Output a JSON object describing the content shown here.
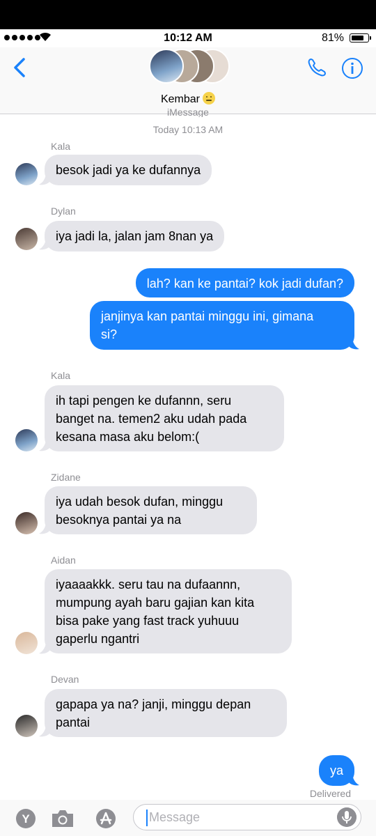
{
  "status_bar": {
    "time": "10:12 AM",
    "battery_percent": "81%",
    "battery_level": 0.81,
    "signal_bars": 5
  },
  "header": {
    "back_icon": "chevron-left-icon",
    "contact_name": "Kembar",
    "contact_emoji": "neutral-face-emoji",
    "phone_icon": "phone-icon",
    "info_icon": "info-icon",
    "accent_color": "#1a82fb"
  },
  "thread": {
    "service_label": "iMessage",
    "timestamp": "Today 10:13 AM",
    "delivered_label": "Delivered"
  },
  "messages": [
    {
      "sender": "Kala",
      "direction": "incoming",
      "lines": [
        "besok jadi ya ke dufannya"
      ]
    },
    {
      "sender": "Dylan",
      "direction": "incoming",
      "lines": [
        "iya jadi la, jalan jam 8nan ya"
      ]
    },
    {
      "sender": "",
      "direction": "outgoing",
      "lines": [
        "lah? kan ke pantai? kok jadi dufan?"
      ]
    },
    {
      "sender": "",
      "direction": "outgoing",
      "lines": [
        "janjinya kan pantai minggu ini, gimana",
        "si?"
      ]
    },
    {
      "sender": "Kala",
      "direction": "incoming",
      "lines": [
        "ih tapi pengen ke dufannn, seru",
        "banget na. temen2 aku udah pada",
        "kesana masa aku belom:("
      ]
    },
    {
      "sender": "Zidane",
      "direction": "incoming",
      "lines": [
        "iya udah besok dufan, minggu",
        "besoknya pantai ya na"
      ]
    },
    {
      "sender": "Aidan",
      "direction": "incoming",
      "lines": [
        "iyaaaakkk. seru tau na dufaannn,",
        "mumpung ayah baru gajian kan kita",
        "bisa pake yang fast track yuhuuu",
        "gaperlu ngantri"
      ]
    },
    {
      "sender": "Devan",
      "direction": "incoming",
      "lines": [
        "gapapa ya na? janji, minggu depan",
        "pantai"
      ]
    },
    {
      "sender": "",
      "direction": "outgoing",
      "lines": [
        "ya"
      ]
    }
  ],
  "composer": {
    "placeholder": "Message",
    "app_icons": [
      "y-app-icon",
      "camera-icon",
      "app-store-icon"
    ],
    "mic_icon": "microphone-icon"
  },
  "colors": {
    "incoming_bubble": "#e5e5ea",
    "outgoing_bubble": "#1a82fb",
    "meta_text": "#8e8e93"
  }
}
